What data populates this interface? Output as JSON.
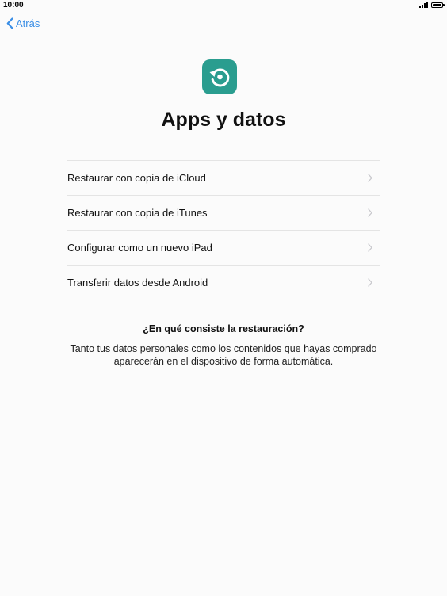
{
  "status_bar": {
    "time": "10:00",
    "signal_icon": "cellular-signal-icon",
    "battery_icon": "battery-icon"
  },
  "nav": {
    "back_label": "Atrás",
    "back_icon": "chevron-left-icon"
  },
  "header": {
    "icon": "restore-icon",
    "icon_color": "#2a9d8f",
    "title": "Apps y datos"
  },
  "options": [
    {
      "label": "Restaurar con copia de iCloud"
    },
    {
      "label": "Restaurar con copia de iTunes"
    },
    {
      "label": "Configurar como un nuevo iPad"
    },
    {
      "label": "Transferir datos desde Android"
    }
  ],
  "info": {
    "title": "¿En qué consiste la restauración?",
    "body": "Tanto tus datos personales como los contenidos que hayas comprado aparecerán en el dispositivo de forma automática."
  },
  "colors": {
    "accent": "#3a8ee6",
    "background": "#fbfbfb",
    "divider": "#e4e4e4"
  }
}
